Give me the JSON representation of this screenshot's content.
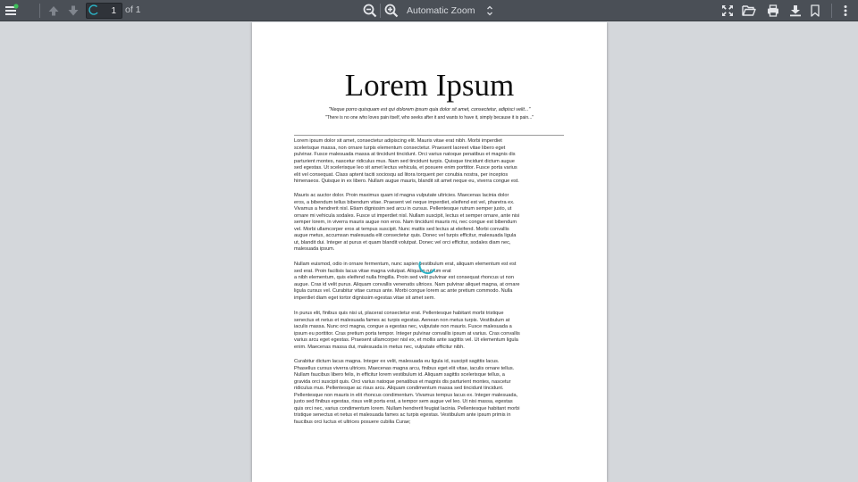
{
  "toolbar": {
    "page_number": "1",
    "page_count": "of 1",
    "zoom_label": "Automatic Zoom",
    "icons": {
      "sidebar_toggle": "sidebar-toggle-icon",
      "prev": "arrow-up-icon",
      "next": "arrow-down-icon",
      "zoom_out": "zoom-out-icon",
      "zoom_in": "zoom-in-icon",
      "presentation": "fullscreen-icon",
      "open": "folder-open-icon",
      "print": "printer-icon",
      "download": "download-icon",
      "bookmark": "bookmark-icon",
      "tools": "more-vertical-icon"
    },
    "accent_color": "#3dbf5a"
  },
  "document": {
    "title": "Lorem Ipsum",
    "quote": "\"Neque porro quisquam est qui dolorem ipsum quia dolor sit amet, consectetur, adipisci velit...\"",
    "subquote": "\"There is no one who loves pain itself, who seeks after it and wants to have it, simply because it is pain...\"",
    "paragraphs": [
      "Lorem ipsum dolor sit amet, consectetur adipiscing elit. Mauris vitae erat nibh. Morbi imperdiet\nscelerisque massa, non ornare turpis elementum consectetur. Praesent laoreet vitae libero eget\npulvinar. Fusce malesuada massa at tincidunt tincidunt. Orci varius natoque penatibus et magnis dis\nparturient montes, nascetur ridiculus mus. Nam sed tincidunt turpis. Quisque tincidunt dictum augue\nsed egestas. Ut scelerisque leo sit amet lectus vehicula, et posuere enim porttitor. Fusce porta varius\nelit vel consequat. Class aptent taciti sociosqu ad litora torquent per conubia nostra, per inceptos\nhimenaeos. Quisque in ex libero. Nullam augue mauris, blandit sit amet neque eu, viverra congue est.",
      "Mauris ac auctor dolor. Proin maximus quam id magna vulputate ultricies. Maecenas lacinia dolor\neros, a bibendum tellus bibendum vitae. Praesent vel neque imperdiet, eleifend est vel, pharetra ex.\nVivamus a hendrerit nisl. Etiam dignissim sed arcu in cursus. Pellentesque rutrum semper justo, ut\nornare mi vehicula sodales. Fusce ut imperdiet nisl. Nullam suscipit, lectus et semper ornare, ante nisi\nsemper lorem, in viverra mauris augue non eros. Nam tincidunt mauris mi, nec congue est bibendum\nvel. Morbi ullamcorper eros at tempus suscipit. Nunc mattis sed lectus at eleifend. Morbi convallis\naugue metus, accumsan malesuada elit consectetur quis. Donec vel turpis efficitur, malesuada ligula\nut, blandit dui. Integer at purus et quam blandit volutpat. Donec vel orci efficitur, sodales diam nec,\nmalesuada ipsum.",
      "Nullam euismod, odio in ornare fermentum, nunc sapien vestibulum erat, aliquam elementum est est\nsed erat. Proin facilisis lacus vitae magna volutpat. Aliquam rutrum erat\na nibh elementum, quis eleifend nulla fringilla. Proin sed velit pulvinar est consequat rhoncus ut non\naugue. Cras id velit purus. Aliquam convallis venenatis ultrices. Nam pulvinar aliquet magna, at ornare\nligula cursus vel. Curabitur vitae cursus ante. Morbi congue lorem ac ante pretium commodo. Nulla\nimperdiet diam eget tortor dignissim egestas vitae sit amet sem.",
      "In purus elit, finibus quis nisi ut, placerat consectetur erat. Pellentesque habitant morbi tristique\nsenectus et netus et malesuada fames ac turpis egestas. Aenean non metus turpis. Vestibulum at\niaculis massa. Nunc orci magna, congue a egestas nec, vulputate non mauris. Fusce malesuada a\nipsum eu porttitor. Cras pretium porta tempor. Integer pulvinar convallis ipsum at varius. Cras convallis\nvarius arcu eget egestas. Praesent ullamcorper nisl ex, et mollis ante sagittis vel. Ut elementum ligula\nenim. Maecenas massa dui, malesuada in metus nec, vulputate efficitur nibh.",
      "Curabitur dictum lacus magna. Integer ex velit, malesuada eu ligula id, suscipit sagittis lacus.\nPhasellus cursus viverra ultrices. Maecenas magna arcu, finibus eget elit vitae, iaculis ornare tellus.\nNullam faucibus libero felis, in efficitur lorem vestibulum id. Aliquam sagittis scelerisque tellus, a\ngravida orci suscipit quis. Orci varius natoque penatibus et magnis dis parturient montes, nascetur\nridiculus mus. Pellentesque ac risus arcu. Aliquam condimentum massa sed tincidunt tincidunt.\nPellentesque non mauris in elit rhoncus condimentum. Vivamus tempus lacus ex. Integer malesuada,\njusto sed finibus egestas, risus velit porta erat, a tempor sem augue vel leo. Ut nisi massa, egestas\nquis orci nec, varius condimentum lorem. Nullam hendrerit feugiat lacinia. Pellentesque habitant morbi\ntristique senectus et netus et malesuada fames ac turpis egestas. Vestibulum ante ipsum primis in\nfaucibus orci luctus et ultrices posuere cubilia Curae;"
    ],
    "spinner_color": "#2bb5c8"
  }
}
